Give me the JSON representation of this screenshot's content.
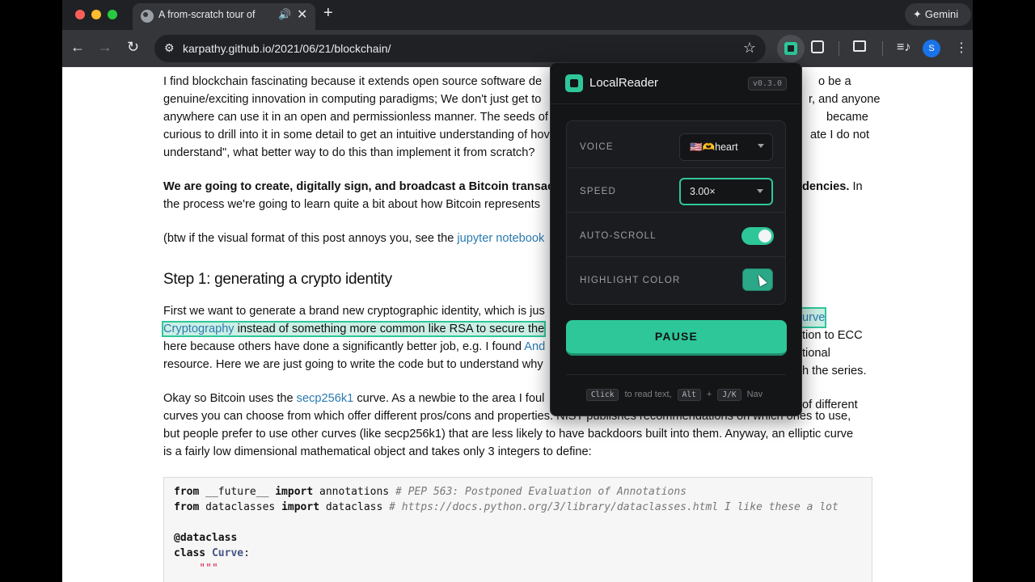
{
  "browser": {
    "tab_title": "A from-scratch tour of Bit",
    "tab_audio_icon": "🔊",
    "tab_close": "✕",
    "new_tab": "+",
    "gemini_label": "Gemini",
    "url": "karpathy.github.io/2021/06/21/blockchain/",
    "avatar_initial": "S"
  },
  "article": {
    "p1": "I find blockchain fascinating because it extends open source software de",
    "p1_tail_a": "o be a",
    "p1_l2": "genuine/exciting innovation in computing paradigms; We don't just get to ",
    "p1_l2_tail": "r, and anyone",
    "p1_l3": "anywhere can use it in an open and permissionless manner. The seeds of",
    "p1_l3_tail": "became",
    "p1_l4": "curious to drill into it in some detail to get an intuitive understanding of hov",
    "p1_l4_tail": "ate I do not",
    "p1_l5": "understand\", what better way to do this than implement it from scratch?",
    "p2_bold": "We are going to create, digitally sign, and broadcast a Bitcoin transaction i",
    "p2_bold_tail": "dencies.",
    "p2_tail_plain": " In",
    "p2_l2": "the process we're going to learn quite a bit about how Bitcoin represents ",
    "p3_text": "(btw if the visual format of this post annoys you, see the ",
    "p3_link": "jupyter notebook",
    "h2": "Step 1: generating a crypto identity",
    "p4_l1": "First we want to generate a brand new cryptographic identity, which is jus",
    "p4_l1_link_tail": "urve",
    "p4_l2_link": "Cryptography",
    "p4_l2": " instead of something more common like RSA to secure the",
    "p4_l2_tail": "tion to ECC",
    "p4_l3": "here because others have done a significantly better job, e.g. I found ",
    "p4_l3_link": "And",
    "p4_l3_tail": "tional",
    "p4_l4": "resource. Here we are just going to write the code but to understand why ",
    "p4_l4_tail": "h the series.",
    "p5_l1a": "Okay so Bitcoin uses the ",
    "p5_l1_link": "secp256k1",
    "p5_l1b": " curve. As a newbie to the area I foul",
    "p5_l1_tail": "of different",
    "p5_l2": "curves you can choose from which offer different pros/cons and properties. NIST publishes recommendations on which ones to use,",
    "p5_l3": "but people prefer to use other curves (like secp256k1) that are less likely to have backdoors built into them. Anyway, an elliptic curve",
    "p5_l4": "is a fairly low dimensional mathematical object and takes only 3 integers to define:"
  },
  "code": {
    "l1_kw1": "from",
    "l1_mod": " __future__ ",
    "l1_kw2": "import",
    "l1_name": " annotations ",
    "l1_comment": "# PEP 563: Postponed Evaluation of Annotations",
    "l2_kw1": "from",
    "l2_mod": " dataclasses ",
    "l2_kw2": "import",
    "l2_name": " dataclass ",
    "l2_comment": "# https://docs.python.org/3/library/dataclasses.html I like these a lot",
    "l4": "@dataclass",
    "l5_kw": "class",
    "l5_name": "Curve",
    "l5_colon": ":",
    "l6": "    \"\"\""
  },
  "reader": {
    "title": "LocalReader",
    "version": "v0.3.0",
    "voice_label": "VOICE",
    "voice_value": "🇺🇸🫶heart",
    "speed_label": "SPEED",
    "speed_value": "3.00×",
    "autoscroll_label": "AUTO-SCROLL",
    "autoscroll_on": true,
    "highlight_label": "HIGHLIGHT COLOR",
    "highlight_color": "#2ba888",
    "pause_label": "PAUSE",
    "help_click": "Click",
    "help_click_text": "to read text,",
    "help_alt": "Alt",
    "help_plus": "+",
    "help_jk": "J/K",
    "help_nav": "Nav",
    "accent": "#2ec79a"
  }
}
